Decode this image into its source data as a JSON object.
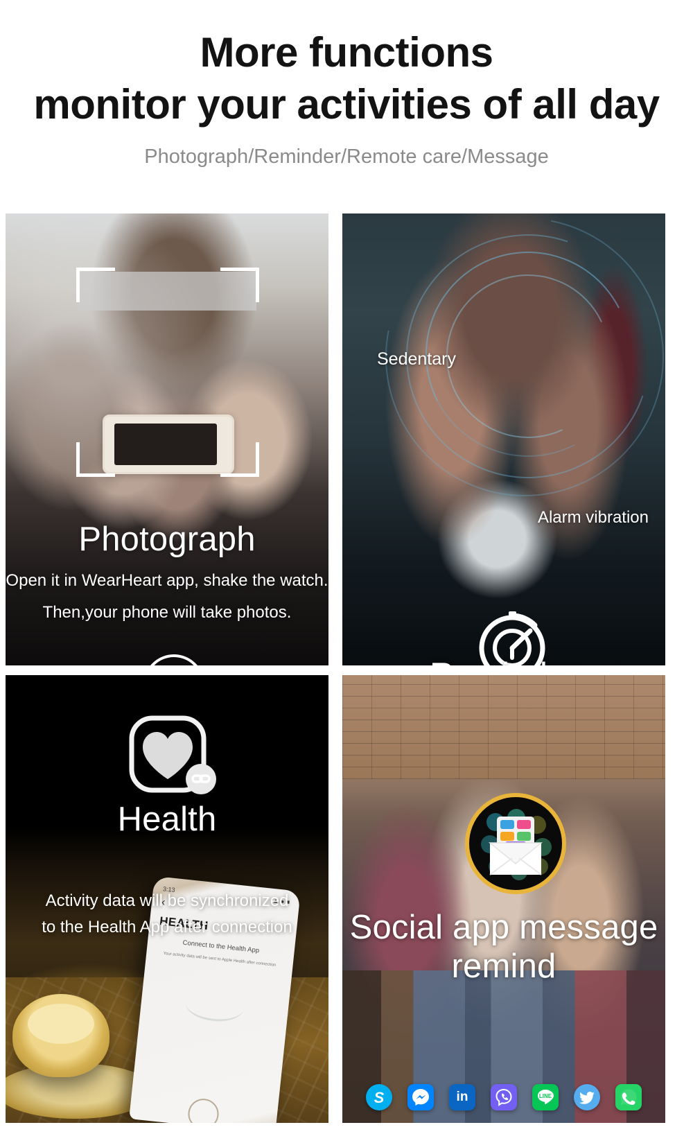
{
  "header": {
    "headline_line1": "More functions",
    "headline_line2": "monitor your activities of all day",
    "subhead": "Photograph/Reminder/Remote care/Message"
  },
  "panels": {
    "photograph": {
      "title": "Photograph",
      "caption_line1": "Open it in WearHeart app, shake the watch.",
      "caption_line2": "Then,your phone will take photos.",
      "icon": "camera-icon"
    },
    "reminder": {
      "title": "Reminder",
      "label_top_left": "Sedentary",
      "label_bottom_right": "Alarm vibration",
      "icon": "stopwatch-timer-icon",
      "ring_color": "#6eb4d7"
    },
    "health": {
      "title": "Health",
      "caption_line1": "Activity data will be synchronized",
      "caption_line2": "to the Health App after connection",
      "icon": "heart-app-link-icon",
      "phone_screen": {
        "time": "3:13",
        "back": "‹",
        "title": "HEALTH",
        "subtitle": "Connect to the Health App",
        "body": "Your activity data will be sent to Apple Health after connection"
      }
    },
    "social": {
      "title_line1": "Social app message",
      "title_line2": "remind",
      "icon": "envelope-apps-icon",
      "ring_color": "#e8b43a",
      "apps": [
        {
          "name": "skype",
          "label": "S",
          "color": "#00AFF0"
        },
        {
          "name": "messenger",
          "label": "",
          "color": "#0084FF"
        },
        {
          "name": "linkedin",
          "label": "in",
          "color": "#0A66C2"
        },
        {
          "name": "viber",
          "label": "",
          "color": "#7360F2"
        },
        {
          "name": "line",
          "label": "LINE",
          "color": "#06C755"
        },
        {
          "name": "twitter",
          "label": "",
          "color": "#55ACEE"
        },
        {
          "name": "whatsapp",
          "label": "",
          "color": "#25D366"
        }
      ]
    }
  }
}
